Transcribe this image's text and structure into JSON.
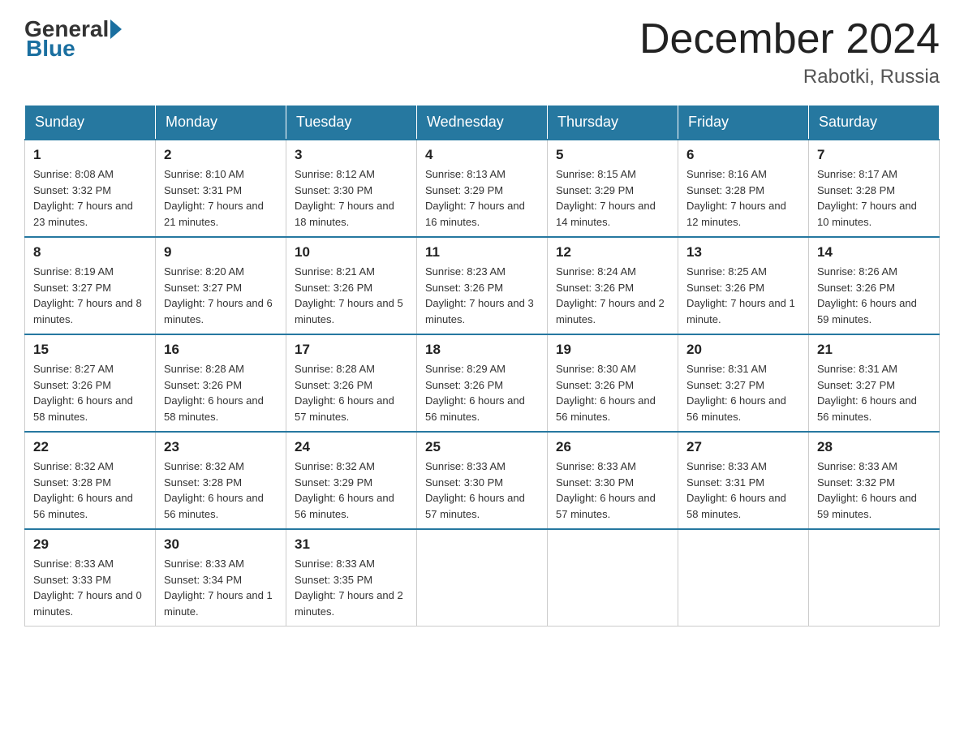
{
  "header": {
    "logo_text_general": "General",
    "logo_text_blue": "Blue",
    "title": "December 2024",
    "subtitle": "Rabotki, Russia"
  },
  "days_of_week": [
    "Sunday",
    "Monday",
    "Tuesday",
    "Wednesday",
    "Thursday",
    "Friday",
    "Saturday"
  ],
  "weeks": [
    [
      {
        "day": "1",
        "sunrise": "8:08 AM",
        "sunset": "3:32 PM",
        "daylight": "7 hours and 23 minutes."
      },
      {
        "day": "2",
        "sunrise": "8:10 AM",
        "sunset": "3:31 PM",
        "daylight": "7 hours and 21 minutes."
      },
      {
        "day": "3",
        "sunrise": "8:12 AM",
        "sunset": "3:30 PM",
        "daylight": "7 hours and 18 minutes."
      },
      {
        "day": "4",
        "sunrise": "8:13 AM",
        "sunset": "3:29 PM",
        "daylight": "7 hours and 16 minutes."
      },
      {
        "day": "5",
        "sunrise": "8:15 AM",
        "sunset": "3:29 PM",
        "daylight": "7 hours and 14 minutes."
      },
      {
        "day": "6",
        "sunrise": "8:16 AM",
        "sunset": "3:28 PM",
        "daylight": "7 hours and 12 minutes."
      },
      {
        "day": "7",
        "sunrise": "8:17 AM",
        "sunset": "3:28 PM",
        "daylight": "7 hours and 10 minutes."
      }
    ],
    [
      {
        "day": "8",
        "sunrise": "8:19 AM",
        "sunset": "3:27 PM",
        "daylight": "7 hours and 8 minutes."
      },
      {
        "day": "9",
        "sunrise": "8:20 AM",
        "sunset": "3:27 PM",
        "daylight": "7 hours and 6 minutes."
      },
      {
        "day": "10",
        "sunrise": "8:21 AM",
        "sunset": "3:26 PM",
        "daylight": "7 hours and 5 minutes."
      },
      {
        "day": "11",
        "sunrise": "8:23 AM",
        "sunset": "3:26 PM",
        "daylight": "7 hours and 3 minutes."
      },
      {
        "day": "12",
        "sunrise": "8:24 AM",
        "sunset": "3:26 PM",
        "daylight": "7 hours and 2 minutes."
      },
      {
        "day": "13",
        "sunrise": "8:25 AM",
        "sunset": "3:26 PM",
        "daylight": "7 hours and 1 minute."
      },
      {
        "day": "14",
        "sunrise": "8:26 AM",
        "sunset": "3:26 PM",
        "daylight": "6 hours and 59 minutes."
      }
    ],
    [
      {
        "day": "15",
        "sunrise": "8:27 AM",
        "sunset": "3:26 PM",
        "daylight": "6 hours and 58 minutes."
      },
      {
        "day": "16",
        "sunrise": "8:28 AM",
        "sunset": "3:26 PM",
        "daylight": "6 hours and 58 minutes."
      },
      {
        "day": "17",
        "sunrise": "8:28 AM",
        "sunset": "3:26 PM",
        "daylight": "6 hours and 57 minutes."
      },
      {
        "day": "18",
        "sunrise": "8:29 AM",
        "sunset": "3:26 PM",
        "daylight": "6 hours and 56 minutes."
      },
      {
        "day": "19",
        "sunrise": "8:30 AM",
        "sunset": "3:26 PM",
        "daylight": "6 hours and 56 minutes."
      },
      {
        "day": "20",
        "sunrise": "8:31 AM",
        "sunset": "3:27 PM",
        "daylight": "6 hours and 56 minutes."
      },
      {
        "day": "21",
        "sunrise": "8:31 AM",
        "sunset": "3:27 PM",
        "daylight": "6 hours and 56 minutes."
      }
    ],
    [
      {
        "day": "22",
        "sunrise": "8:32 AM",
        "sunset": "3:28 PM",
        "daylight": "6 hours and 56 minutes."
      },
      {
        "day": "23",
        "sunrise": "8:32 AM",
        "sunset": "3:28 PM",
        "daylight": "6 hours and 56 minutes."
      },
      {
        "day": "24",
        "sunrise": "8:32 AM",
        "sunset": "3:29 PM",
        "daylight": "6 hours and 56 minutes."
      },
      {
        "day": "25",
        "sunrise": "8:33 AM",
        "sunset": "3:30 PM",
        "daylight": "6 hours and 57 minutes."
      },
      {
        "day": "26",
        "sunrise": "8:33 AM",
        "sunset": "3:30 PM",
        "daylight": "6 hours and 57 minutes."
      },
      {
        "day": "27",
        "sunrise": "8:33 AM",
        "sunset": "3:31 PM",
        "daylight": "6 hours and 58 minutes."
      },
      {
        "day": "28",
        "sunrise": "8:33 AM",
        "sunset": "3:32 PM",
        "daylight": "6 hours and 59 minutes."
      }
    ],
    [
      {
        "day": "29",
        "sunrise": "8:33 AM",
        "sunset": "3:33 PM",
        "daylight": "7 hours and 0 minutes."
      },
      {
        "day": "30",
        "sunrise": "8:33 AM",
        "sunset": "3:34 PM",
        "daylight": "7 hours and 1 minute."
      },
      {
        "day": "31",
        "sunrise": "8:33 AM",
        "sunset": "3:35 PM",
        "daylight": "7 hours and 2 minutes."
      },
      null,
      null,
      null,
      null
    ]
  ]
}
